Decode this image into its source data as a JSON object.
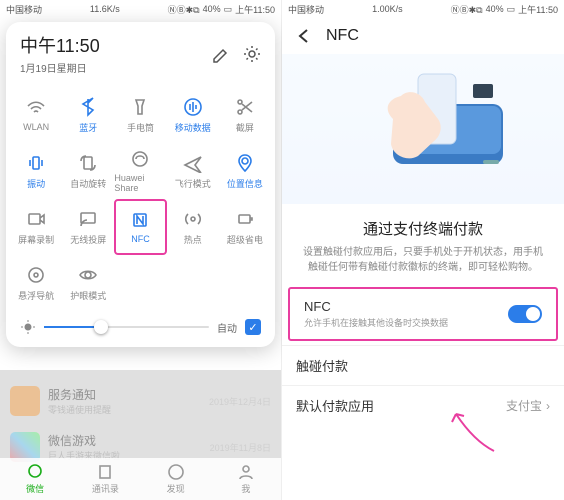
{
  "status": {
    "carrier_l": "中国移动",
    "net_l": "11.6K/s",
    "battery_l": "40%",
    "time_l": "上午11:50",
    "carrier_r": "中国移动",
    "net_r": "1.00K/s",
    "battery_r": "40%",
    "time_r": "上午11:50"
  },
  "panel": {
    "time": "中午11:50",
    "date": "1月19日星期日",
    "brightness_auto": "自动",
    "tiles": [
      {
        "label": "WLAN",
        "on": false
      },
      {
        "label": "蓝牙",
        "on": true
      },
      {
        "label": "手电筒",
        "on": false
      },
      {
        "label": "移动数据",
        "on": true
      },
      {
        "label": "截屏",
        "on": false
      },
      {
        "label": "振动",
        "on": true
      },
      {
        "label": "自动旋转",
        "on": false
      },
      {
        "label": "Huawei Share",
        "on": false
      },
      {
        "label": "飞行模式",
        "on": false
      },
      {
        "label": "位置信息",
        "on": true
      },
      {
        "label": "屏幕录制",
        "on": false
      },
      {
        "label": "无线投屏",
        "on": false
      },
      {
        "label": "NFC",
        "on": true,
        "hot": true
      },
      {
        "label": "热点",
        "on": false
      },
      {
        "label": "超级省电",
        "on": false
      },
      {
        "label": "悬浮导航",
        "on": false
      },
      {
        "label": "护眼模式",
        "on": false
      }
    ]
  },
  "bg": {
    "item1": "服务通知",
    "item1_date": "2019年12月4日",
    "item2": "微信游戏",
    "item2_date": "2019年11月8日",
    "tabs": [
      "微信",
      "通讯录",
      "发现",
      "我"
    ]
  },
  "nfc": {
    "title": "NFC",
    "section_h": "通过支付终端付款",
    "section_p": "设置触碰付款应用后，只要手机处于开机状态，用手机触碰任何带有触碰付款徽标的终端，即可轻松购物。",
    "row_nfc": "NFC",
    "row_nfc_sub": "允许手机在接触其他设备时交换数据",
    "row_tap": "触碰付款",
    "row_default": "默认付款应用",
    "row_default_val": "支付宝"
  }
}
